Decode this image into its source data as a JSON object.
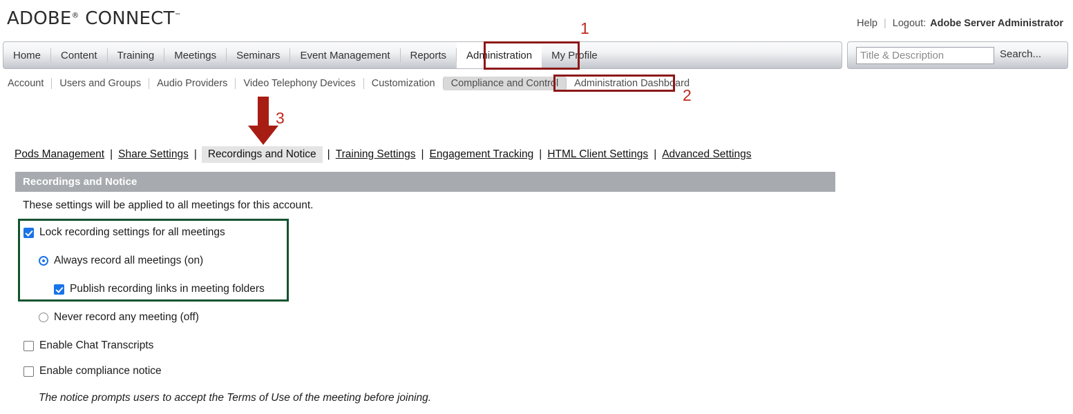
{
  "branding": {
    "logo_main": "ADOBE",
    "logo_sup": "®",
    "logo_second": " CONNECT",
    "logo_tm": "™"
  },
  "account_bar": {
    "help": "Help",
    "logout_label": "Logout:",
    "user_name": "Adobe Server Administrator"
  },
  "main_nav": {
    "items": [
      {
        "label": "Home",
        "active": false
      },
      {
        "label": "Content",
        "active": false
      },
      {
        "label": "Training",
        "active": false
      },
      {
        "label": "Meetings",
        "active": false
      },
      {
        "label": "Seminars",
        "active": false
      },
      {
        "label": "Event Management",
        "active": false
      },
      {
        "label": "Reports",
        "active": false
      },
      {
        "label": "Administration",
        "active": true
      },
      {
        "label": "My Profile",
        "active": false
      }
    ]
  },
  "search": {
    "placeholder": "Title & Description",
    "value": "",
    "button_label": "Search..."
  },
  "sub_nav": {
    "items": [
      {
        "label": "Account",
        "selected": false
      },
      {
        "label": "Users and Groups",
        "selected": false
      },
      {
        "label": "Audio Providers",
        "selected": false
      },
      {
        "label": "Video Telephony Devices",
        "selected": false
      },
      {
        "label": "Customization",
        "selected": false
      },
      {
        "label": "Compliance and Control",
        "selected": true
      },
      {
        "label": "Administration Dashboard",
        "selected": false
      }
    ]
  },
  "tab_links": {
    "items": [
      {
        "label": "Pods Management",
        "current": false
      },
      {
        "label": "Share Settings",
        "current": false
      },
      {
        "label": "Recordings and Notice",
        "current": true
      },
      {
        "label": "Training Settings",
        "current": false
      },
      {
        "label": "Engagement Tracking",
        "current": false
      },
      {
        "label": "HTML Client Settings",
        "current": false
      },
      {
        "label": "Advanced Settings",
        "current": false
      }
    ],
    "separator": "|"
  },
  "section": {
    "title": "Recordings and Notice",
    "intro": "These settings will be applied to all meetings for this account."
  },
  "form": {
    "lock_recording": {
      "label": "Lock recording settings for all meetings",
      "checked": true
    },
    "always_record": {
      "label": "Always record all meetings (on)",
      "selected": true
    },
    "publish_links": {
      "label": "Publish recording links in meeting folders",
      "checked": true
    },
    "never_record": {
      "label": "Never record any meeting (off)",
      "selected": false
    },
    "enable_chat_transcripts": {
      "label": "Enable Chat Transcripts",
      "checked": false
    },
    "enable_compliance_notice": {
      "label": "Enable compliance notice",
      "checked": false
    },
    "notice_hint": "The notice prompts users to accept the Terms of Use of the meeting before joining."
  },
  "annotations": {
    "step1": "1",
    "step2": "2",
    "step3": "3",
    "box_color": "#8c1818",
    "number_color": "#c0281c",
    "arrow_color": "#a81d13",
    "highlight_color": "#13532f"
  }
}
